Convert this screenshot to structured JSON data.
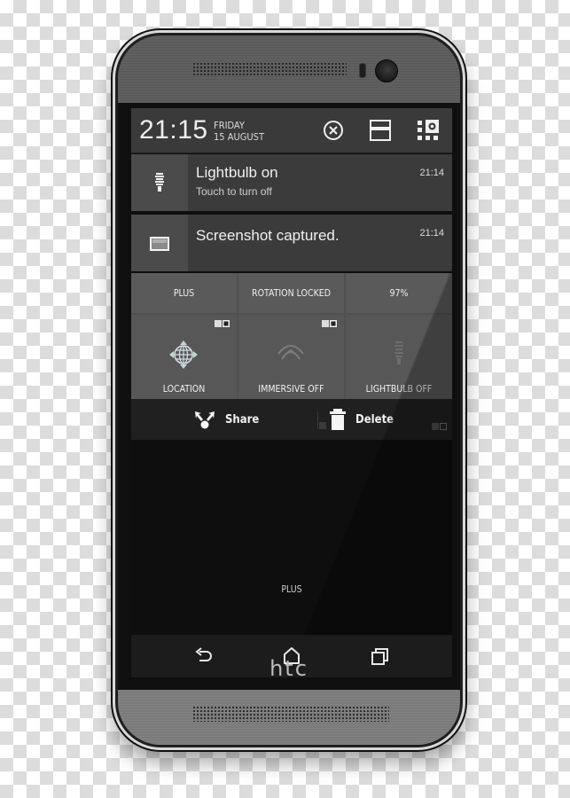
{
  "device": {
    "brand_logo": "htc"
  },
  "status_bar": {
    "time": "21:15",
    "day": "FRIDAY",
    "date": "15 AUGUST",
    "icons": [
      "clear-notifications-icon",
      "toggle-panel-icon",
      "quick-settings-icon"
    ]
  },
  "notifications": [
    {
      "icon": "lightbulb-icon",
      "title": "Lightbulb on",
      "subtitle": "Touch to turn off",
      "time": "21:14"
    },
    {
      "icon": "screenshot-icon",
      "title": "Screenshot captured.",
      "subtitle": "",
      "time": "21:14"
    }
  ],
  "quick_settings": {
    "top_row": [
      {
        "label": "PLUS"
      },
      {
        "label": "ROTATION LOCKED"
      },
      {
        "label": "97%"
      }
    ],
    "bottom_row": [
      {
        "label": "LOCATION",
        "icon": "location-globe-icon",
        "has_toggle": true
      },
      {
        "label": "IMMERSIVE OFF",
        "icon": "immersive-icon",
        "has_toggle": true
      },
      {
        "label": "LIGHTBULB OFF",
        "icon": "lightbulb-icon",
        "has_toggle": false
      }
    ]
  },
  "actions": {
    "share_label": "Share",
    "delete_label": "Delete"
  },
  "home_screen": {
    "label": "PLUS"
  },
  "nav_bar": {
    "buttons": [
      "back",
      "home",
      "recents"
    ]
  }
}
